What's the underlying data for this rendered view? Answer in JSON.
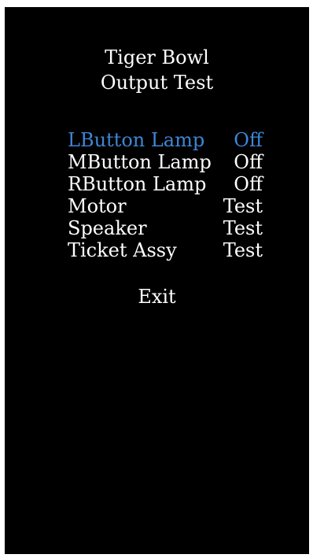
{
  "header": {
    "line1": "Tiger Bowl",
    "line2": "Output Test"
  },
  "colors": {
    "background": "#000000",
    "text": "#ffffff",
    "selected": "#3e86d6"
  },
  "menu": {
    "items": [
      {
        "label": "LButton Lamp",
        "value": "Off",
        "selected": true
      },
      {
        "label": "MButton Lamp",
        "value": "Off",
        "selected": false
      },
      {
        "label": "RButton Lamp",
        "value": "Off",
        "selected": false
      },
      {
        "label": "Motor",
        "value": "Test",
        "selected": false
      },
      {
        "label": "Speaker",
        "value": "Test",
        "selected": false
      },
      {
        "label": "Ticket Assy",
        "value": "Test",
        "selected": false
      }
    ],
    "exit_label": "Exit"
  }
}
